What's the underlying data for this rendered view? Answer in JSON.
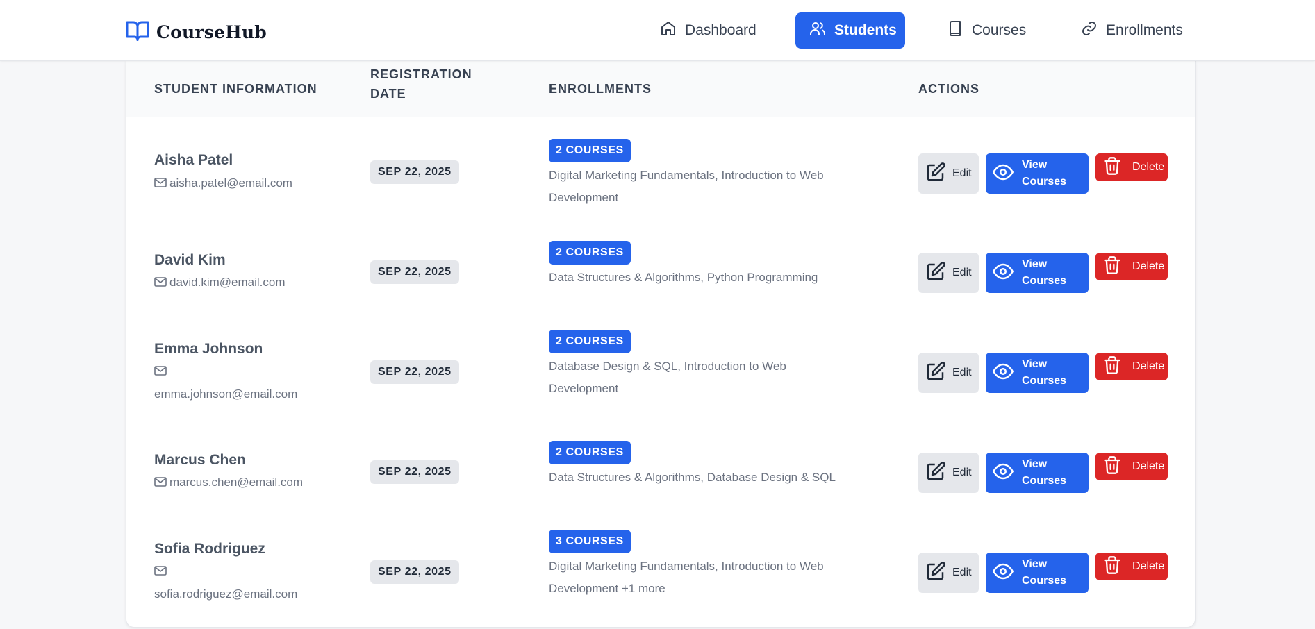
{
  "app": {
    "name": "CourseHub"
  },
  "nav": [
    {
      "label": "Dashboard",
      "icon": "home-icon",
      "active": false
    },
    {
      "label": "Students",
      "icon": "users-icon",
      "active": true
    },
    {
      "label": "Courses",
      "icon": "book-icon",
      "active": false
    },
    {
      "label": "Enrollments",
      "icon": "link-icon",
      "active": false
    }
  ],
  "table": {
    "headers": {
      "student": "STUDENT INFORMATION",
      "date": "REGISTRATION DATE",
      "enrollments": "ENROLLMENTS",
      "actions": "ACTIONS"
    },
    "actions": {
      "edit": "Edit",
      "view": "View Courses",
      "delete": "Delete"
    },
    "rows": [
      {
        "name": "Aisha Patel",
        "email": "aisha.patel@email.com",
        "date": "SEP 22, 2025",
        "count": "2 COURSES",
        "courses": "Digital Marketing Fundamentals, Introduction to Web Development"
      },
      {
        "name": "David Kim",
        "email": "david.kim@email.com",
        "date": "SEP 22, 2025",
        "count": "2 COURSES",
        "courses": "Data Structures & Algorithms, Python Programming"
      },
      {
        "name": "Emma Johnson",
        "email": "emma.johnson@email.com",
        "date": "SEP 22, 2025",
        "count": "2 COURSES",
        "courses": "Database Design & SQL, Introduction to Web Development"
      },
      {
        "name": "Marcus Chen",
        "email": "marcus.chen@email.com",
        "date": "SEP 22, 2025",
        "count": "2 COURSES",
        "courses": "Data Structures & Algorithms, Database Design & SQL"
      },
      {
        "name": "Sofia Rodriguez",
        "email": "sofia.rodriguez@email.com",
        "date": "SEP 22, 2025",
        "count": "3 COURSES",
        "courses": "Digital Marketing Fundamentals, Introduction to Web Development +1 more"
      }
    ]
  },
  "colors": {
    "primary": "#2563eb",
    "danger": "#dc2626",
    "neutral_button": "#e5e7eb",
    "page_bg": "#f6f7f9"
  }
}
